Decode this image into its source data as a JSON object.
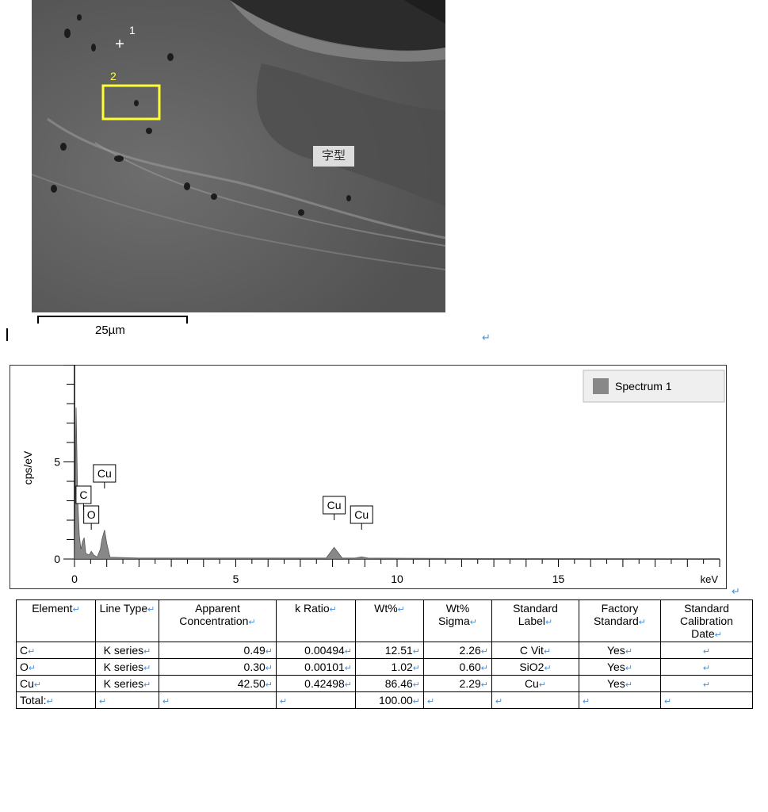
{
  "sem": {
    "marker1_label": "1",
    "marker2_label": "2",
    "overlay_label": "字型",
    "scale_label": "25µm",
    "colors": {
      "frame": "#ffff33",
      "background": "#5b5b5b"
    }
  },
  "chart_data": {
    "type": "line",
    "title": "",
    "xlabel": "keV",
    "ylabel": "cps/eV",
    "xlim": [
      0,
      20
    ],
    "ylim": [
      0,
      10
    ],
    "xticks": [
      0,
      5,
      10,
      15
    ],
    "yticks": [
      5
    ],
    "legend": {
      "entries": [
        "Spectrum 1"
      ],
      "placement": "top-right"
    },
    "series": [
      {
        "name": "Spectrum 1",
        "x": [
          0.0,
          0.05,
          0.1,
          0.15,
          0.2,
          0.25,
          0.3,
          0.35,
          0.45,
          0.52,
          0.6,
          0.7,
          0.8,
          0.85,
          0.93,
          1.0,
          1.1,
          2.0,
          7.8,
          8.05,
          8.3,
          8.7,
          8.9,
          9.1,
          12.0,
          20.0
        ],
        "y": [
          0.0,
          7.8,
          3.0,
          1.2,
          0.5,
          0.9,
          1.1,
          0.3,
          0.2,
          0.4,
          0.2,
          0.1,
          0.5,
          1.0,
          1.5,
          0.8,
          0.1,
          0.05,
          0.05,
          0.6,
          0.05,
          0.05,
          0.12,
          0.05,
          0.03,
          0.0
        ]
      }
    ],
    "annotations": [
      {
        "label": "C",
        "x": 0.28
      },
      {
        "label": "O",
        "x": 0.52
      },
      {
        "label": "Cu",
        "x": 0.93
      },
      {
        "label": "Cu",
        "x": 8.05
      },
      {
        "label": "Cu",
        "x": 8.9
      }
    ],
    "color": "#888888"
  },
  "table": {
    "headers": [
      "Element",
      "Line Type",
      "Apparent Concentration",
      "k Ratio",
      "Wt%",
      "Wt% Sigma",
      "Standard Label",
      "Factory Standard",
      "Standard Calibration Date"
    ],
    "rows": [
      {
        "element": "C",
        "line_type": "K series",
        "apparent": "0.49",
        "k_ratio": "0.00494",
        "wt": "12.51",
        "sigma": "2.26",
        "std_label": "C Vit",
        "factory": "Yes",
        "cal_date": ""
      },
      {
        "element": "O",
        "line_type": "K series",
        "apparent": "0.30",
        "k_ratio": "0.00101",
        "wt": "1.02",
        "sigma": "0.60",
        "std_label": "SiO2",
        "factory": "Yes",
        "cal_date": ""
      },
      {
        "element": "Cu",
        "line_type": "K series",
        "apparent": "42.50",
        "k_ratio": "0.42498",
        "wt": "86.46",
        "sigma": "2.29",
        "std_label": "Cu",
        "factory": "Yes",
        "cal_date": ""
      }
    ],
    "total_label": "Total:",
    "total_wt": "100.00"
  },
  "paragraph_mark": "↵"
}
